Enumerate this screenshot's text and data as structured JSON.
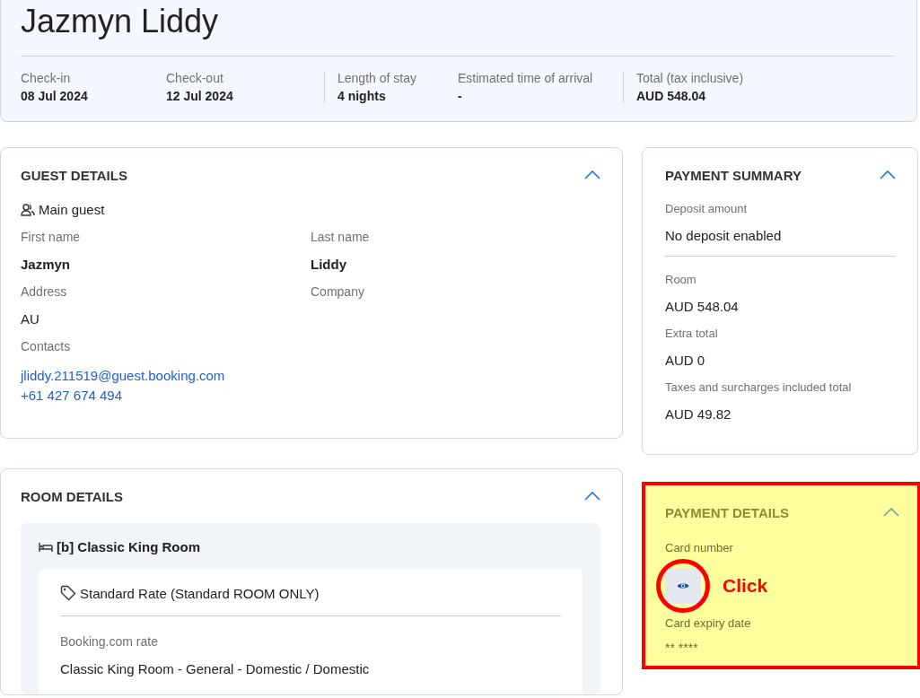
{
  "header": {
    "guest_name": "Jazmyn Liddy",
    "stat_groups": [
      [
        {
          "label": "Check-in",
          "value": "08 Jul 2024"
        },
        {
          "label": "Check-out",
          "value": "12 Jul 2024"
        }
      ],
      [
        {
          "label": "Length of stay",
          "value": "4 nights"
        },
        {
          "label": "Estimated time of arrival",
          "value": "-"
        }
      ],
      [
        {
          "label": "Total (tax inclusive)",
          "value": "AUD 548.04"
        }
      ]
    ]
  },
  "guest_details": {
    "title": "GUEST DETAILS",
    "expanded": true,
    "section": "Main guest",
    "rows": [
      [
        {
          "label": "First name",
          "value": "Jazmyn",
          "kind": "strong"
        },
        {
          "label": "Last name",
          "value": "Liddy",
          "kind": "strong"
        }
      ],
      [
        {
          "label": "Address",
          "value": "AU",
          "kind": "plain"
        },
        {
          "label": "Company",
          "kind": "plain"
        }
      ],
      [
        {
          "label": "Contacts",
          "kind": "links",
          "links": [
            "jliddy.211519@guest.booking.com",
            "+61 427 674 494"
          ]
        }
      ]
    ]
  },
  "room_details": {
    "title": "ROOM DETAILS",
    "expanded": true,
    "room_name": "[b] Classic King Room",
    "rate_name": "Standard Rate (Standard ROOM ONLY)",
    "rate_label": "Booking.com rate",
    "rate_value": "Classic King Room - General - Domestic / Domestic"
  },
  "payment_summary": {
    "title": "PAYMENT SUMMARY",
    "expanded": true,
    "groups": [
      [
        {
          "label": "Deposit amount",
          "value": "No deposit enabled"
        }
      ],
      [
        {
          "label": "Room",
          "value": "AUD 548.04"
        },
        {
          "label": "Extra total",
          "value": "AUD 0"
        },
        {
          "label": "Taxes and surcharges included total",
          "value": "AUD 49.82"
        }
      ]
    ]
  },
  "payment_details": {
    "title": "PAYMENT DETAILS",
    "expanded": true,
    "highlighted": true,
    "annotation": "Click",
    "card_number_label": "Card number",
    "expiry_label": "Card expiry date",
    "expiry_value": "** ****"
  }
}
